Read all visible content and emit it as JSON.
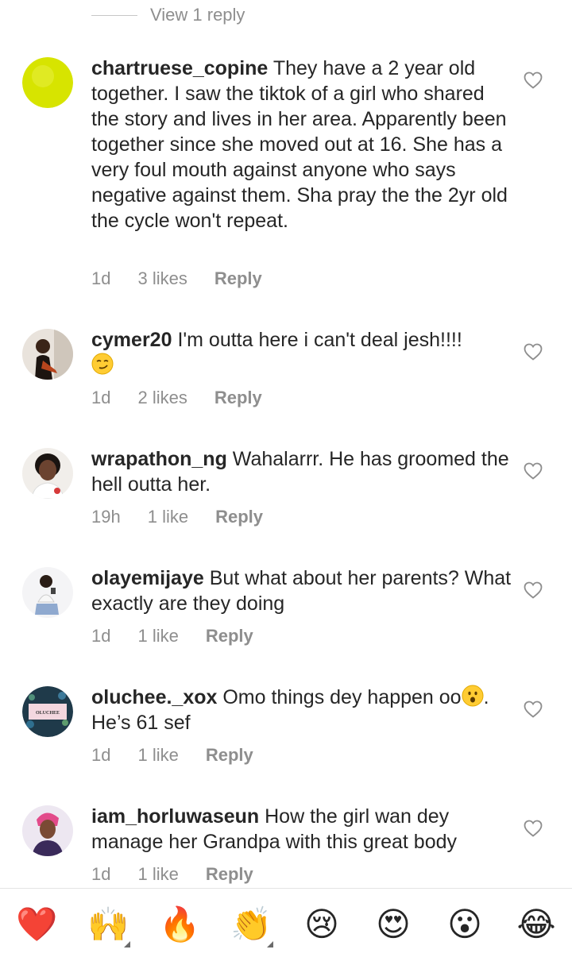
{
  "top": {
    "view_replies": "View 1 reply"
  },
  "comments": [
    {
      "username": "chartruese_copine",
      "text": "They have a 2 year old together. I saw the tiktok of a girl who shared the story and lives in her area. Apparently been together since she moved out at 16. She has a very foul mouth against anyone who says negative against them. Sha pray the the 2yr old the cycle won't repeat.",
      "time": "1d",
      "likes": "3 likes",
      "reply": "Reply"
    },
    {
      "username": "cymer20",
      "text": "I'm outta here i can't deal jesh!!!!",
      "time": "1d",
      "likes": "2 likes",
      "reply": "Reply"
    },
    {
      "username": "wrapathon_ng",
      "text": "Wahalarrr. He has groomed the hell outta her.",
      "time": "19h",
      "likes": "1 like",
      "reply": "Reply"
    },
    {
      "username": "olayemijaye",
      "text": "But what about her parents? What exactly are they doing",
      "time": "1d",
      "likes": "1 like",
      "reply": "Reply"
    },
    {
      "username": "oluchee._xox",
      "text": "Omo things dey happen oo",
      "text_after": ". He’s 61 sef",
      "avatar_text": "OLUCHEE",
      "time": "1d",
      "likes": "1 like",
      "reply": "Reply"
    },
    {
      "username": "iam_horluwaseun",
      "text": "How the girl wan dey manage her Grandpa with this great body",
      "time": "1d",
      "likes": "1 like",
      "reply": "Reply"
    }
  ],
  "reactions": [
    {
      "emoji": "❤️",
      "name": "heart"
    },
    {
      "emoji": "🙌",
      "name": "raised-hands"
    },
    {
      "emoji": "🔥",
      "name": "fire"
    },
    {
      "emoji": "👏",
      "name": "clapping-hands"
    },
    {
      "emoji": "😢",
      "name": "crying-face"
    },
    {
      "emoji": "😍",
      "name": "heart-eyes"
    },
    {
      "emoji": "😮",
      "name": "surprised-face"
    },
    {
      "emoji": "😂",
      "name": "tears-of-joy"
    }
  ],
  "colors": {
    "text": "#262626",
    "muted": "#8e8e8e",
    "heart": "#e0245e"
  }
}
